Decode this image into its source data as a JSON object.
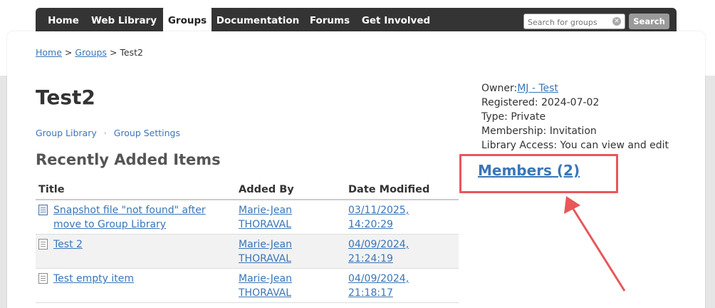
{
  "nav": {
    "items": [
      {
        "label": "Home"
      },
      {
        "label": "Web Library"
      },
      {
        "label": "Groups"
      },
      {
        "label": "Documentation"
      },
      {
        "label": "Forums"
      },
      {
        "label": "Get Involved"
      }
    ],
    "search_placeholder": "Search for groups",
    "search_button": "Search"
  },
  "breadcrumb": {
    "home": "Home",
    "sep1": ">",
    "groups": "Groups",
    "sep2": ">",
    "current": "Test2"
  },
  "page_title": "Test2",
  "group_links": {
    "library": "Group Library",
    "separator": "·",
    "settings": "Group Settings"
  },
  "recent": {
    "title": "Recently Added Items",
    "columns": [
      "Title",
      "Added By",
      "Date Modified"
    ],
    "rows": [
      {
        "title": "Snapshot file \"not found\" after move to Group Library",
        "added_by": "Marie-Jean THORAVAL",
        "date": "03/11/2025, 14:20:29",
        "icon": "snapshot-icon"
      },
      {
        "title": "Test 2",
        "added_by": "Marie-Jean THORAVAL",
        "date": "04/09/2024, 21:24:19",
        "icon": "document-icon"
      },
      {
        "title": "Test empty item",
        "added_by": "Marie-Jean THORAVAL",
        "date": "04/09/2024, 21:18:17",
        "icon": "document-icon"
      }
    ]
  },
  "info": {
    "owner_label": "Owner:",
    "owner_value": "MJ - Test",
    "registered": "Registered: 2024-07-02",
    "type": "Type: Private",
    "membership": "Membership: Invitation",
    "access": "Library Access: You can view and edit"
  },
  "members_link": "Members (2)",
  "colors": {
    "nav_bg": "#343434",
    "link": "#3a76b8",
    "annotation": "#e8575a"
  }
}
